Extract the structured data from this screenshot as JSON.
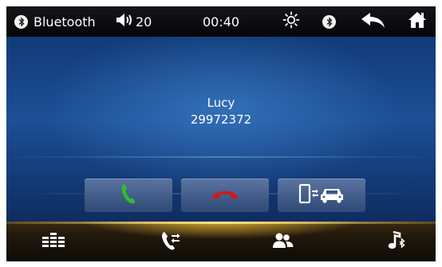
{
  "status_bar": {
    "source_label": "Bluetooth",
    "volume_level": "20",
    "clock": "00:40",
    "icons": [
      "bluetooth-icon",
      "speaker-icon",
      "brightness-icon",
      "bluetooth-icon",
      "back-arrow-icon",
      "home-icon"
    ]
  },
  "call": {
    "contact_name": "Lucy",
    "phone_number": "29972372"
  },
  "call_buttons": [
    {
      "name": "answer-call",
      "icon": "phone-answer-icon",
      "color": "#2fbf2f"
    },
    {
      "name": "end-call",
      "icon": "phone-hangup-icon",
      "color": "#d01818"
    },
    {
      "name": "transfer-audio",
      "icon": "phone-to-car-icon",
      "color": "#ffffff"
    }
  ],
  "bottom_bar": {
    "items": [
      "keypad-icon",
      "call-log-icon",
      "contacts-icon",
      "bluetooth-music-icon"
    ]
  },
  "colors": {
    "status_bar_bg": "#0b0c10",
    "main_bg": "#1c4f96",
    "bottom_glow": "#ffc83c",
    "answer": "#2fbf2f",
    "hangup": "#d01818"
  }
}
